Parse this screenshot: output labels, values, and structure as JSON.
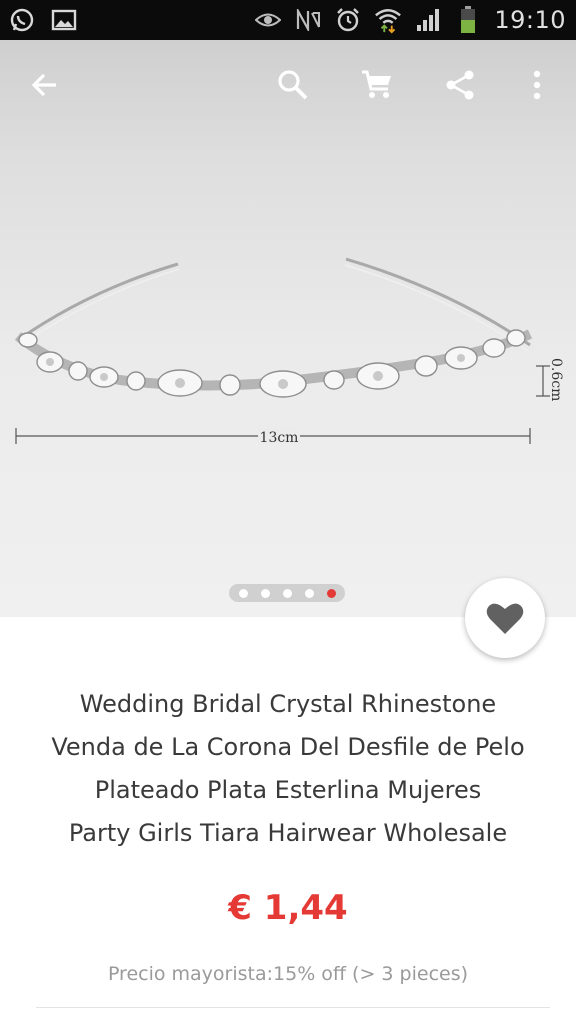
{
  "status_bar": {
    "time": "19:10",
    "icons": [
      "whatsapp-icon",
      "gallery-icon",
      "eye-icon",
      "nfc-icon",
      "alarm-icon",
      "wifi-icon",
      "signal-icon",
      "battery-icon"
    ]
  },
  "toolbar": {
    "icons": [
      "back-arrow-icon",
      "search-icon",
      "cart-icon",
      "share-icon",
      "more-vert-icon"
    ]
  },
  "image": {
    "dimension_width": "13cm",
    "dimension_height": "0.6cm",
    "pager_count": 5,
    "pager_active_index": 4
  },
  "product": {
    "title_lines": [
      "Wedding Bridal Crystal Rhinestone",
      "Venda de La Corona Del Desfile de Pelo",
      "Plateado Plata Esterlina Mujeres",
      "Party Girls Tiara Hairwear Wholesale"
    ],
    "price": "€ 1,44",
    "wholesale_note": "Precio mayorista:15% off (> 3 pieces)"
  },
  "colors": {
    "accent": "#e53935",
    "status_bar": "#0b0b0b",
    "text": "#3a3a3a",
    "muted": "#9a9a9a"
  }
}
